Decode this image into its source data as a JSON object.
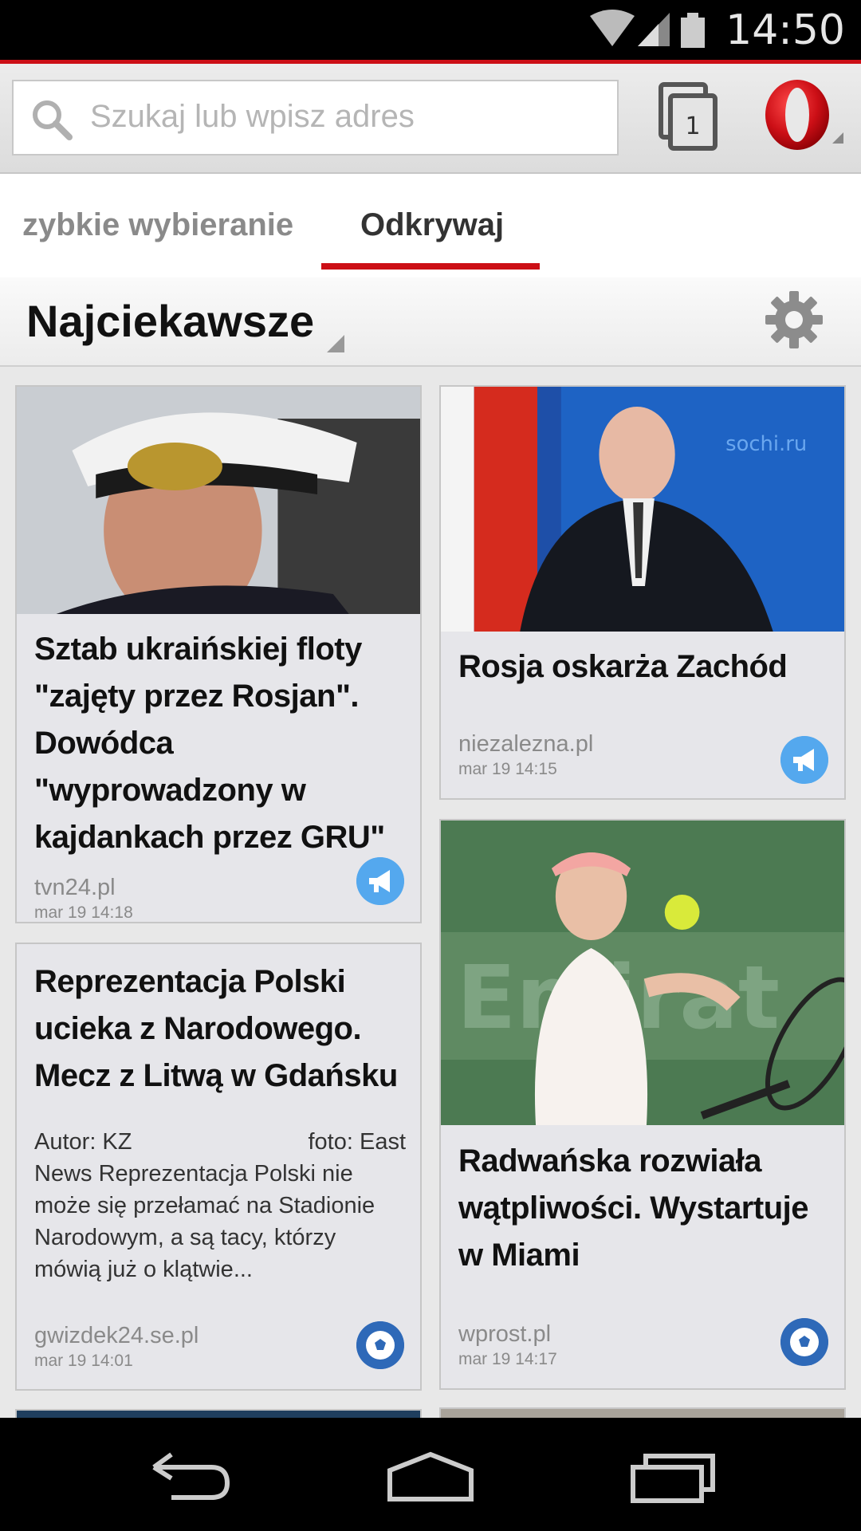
{
  "status_bar": {
    "time": "14:50"
  },
  "toolbar": {
    "search_placeholder": "Szukaj lub wpisz adres",
    "tab_count": "1"
  },
  "tabs": [
    {
      "label": "zybkie wybieranie"
    },
    {
      "label": "Odkrywaj"
    }
  ],
  "category": {
    "title": "Najciekawsze"
  },
  "colors": {
    "accent": "#cc0f16",
    "megaphone_badge": "#54a8ee",
    "ball_badge": "#2e69b8"
  },
  "cards": [
    {
      "headline": "Sztab ukraińskiej floty \"zajęty przez Rosjan\". Dowódca \"wyprowadzony w kajdankach przez GRU\"",
      "source": "tvn24.pl",
      "date": "mar 19 14:18",
      "badge_icon": "megaphone-icon"
    },
    {
      "headline": "Rosja oskarża Zachód",
      "source": "niezalezna.pl",
      "date": "mar 19 14:15",
      "badge_icon": "megaphone-icon"
    },
    {
      "headline": "Reprezentacja Polski ucieka z Narodowego. Mecz z Litwą w Gdańsku",
      "excerpt_author": "Autor: KZ",
      "excerpt_photo": "foto: East",
      "excerpt": "News Reprezentacja Polski nie może się przełamać na Stadionie Narodowym, a są tacy, którzy mówią już o klątwie...",
      "source": "gwizdek24.se.pl",
      "date": "mar 19 14:01",
      "badge_icon": "soccer-ball-icon"
    },
    {
      "headline": "Radwańska rozwiała wątpliwości. Wystartuje w Miami",
      "source": "wprost.pl",
      "date": "mar 19 14:17",
      "badge_icon": "soccer-ball-icon"
    }
  ]
}
